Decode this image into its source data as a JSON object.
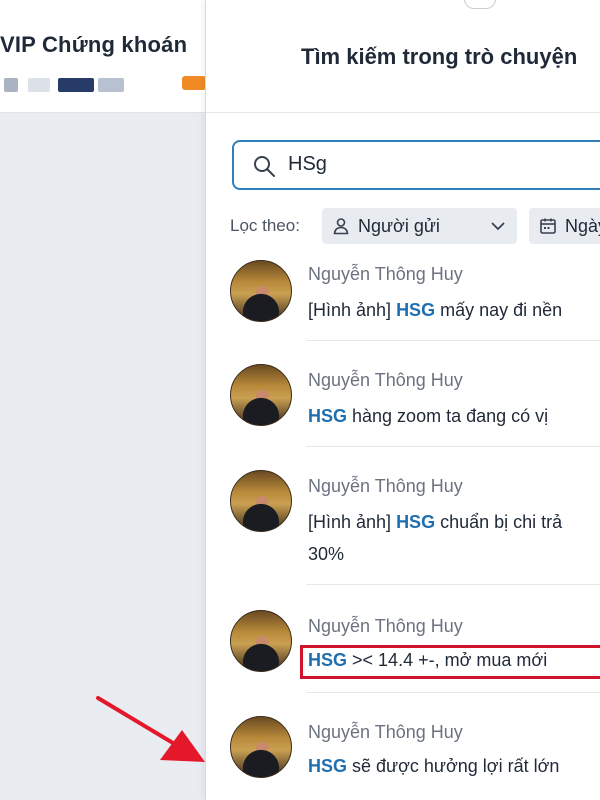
{
  "left_chat": {
    "title": "VIP Chứng khoán"
  },
  "panel": {
    "title": "Tìm kiếm trong trò chuyện"
  },
  "search": {
    "value": "HSg",
    "placeholder": ""
  },
  "filters": {
    "label": "Lọc theo:",
    "sender_chip": "Người gửi",
    "date_chip": "Ngày gửi"
  },
  "results": [
    {
      "sender": "Nguyễn Thông Huy",
      "prefix": "[Hình ảnh] ",
      "keyword": "HSG",
      "rest": " mấy nay đi nền",
      "line2": ""
    },
    {
      "sender": "Nguyễn Thông Huy",
      "prefix": "",
      "keyword": "HSG",
      "rest": " hàng zoom ta đang có vị",
      "line2": ""
    },
    {
      "sender": "Nguyễn Thông Huy",
      "prefix": "[Hình ảnh] ",
      "keyword": "HSG",
      "rest": " chuẩn bị chi trả",
      "line2": "30%"
    },
    {
      "sender": "Nguyễn Thông Huy",
      "prefix": "",
      "keyword": "HSG",
      "rest": " >< 14.4 +-, mở mua mới",
      "line2": ""
    },
    {
      "sender": "Nguyễn Thông Huy",
      "prefix": "",
      "keyword": "HSG",
      "rest": " sẽ được hưởng lợi rất lớn",
      "line2": ""
    }
  ],
  "colors": {
    "accent": "#2f7fbd",
    "keyword": "#1f6fb0",
    "highlight_box": "#d0142c",
    "arrow": "#e3182a",
    "chip_bg": "#e8ebf0"
  }
}
